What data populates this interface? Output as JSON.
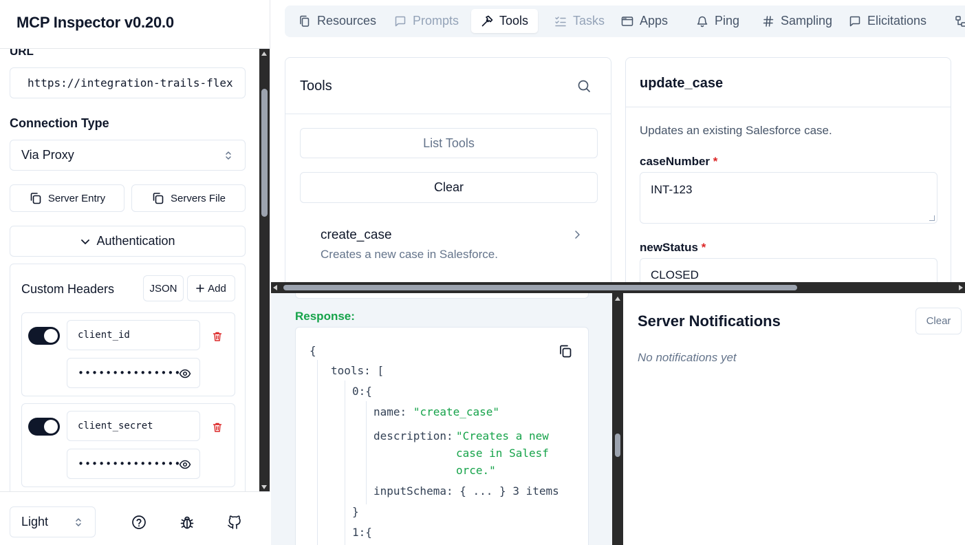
{
  "sidebar": {
    "title": "MCP Inspector v0.20.0",
    "url_label": "URL",
    "url_value": "https://integration-trails-flex",
    "connection_type_label": "Connection Type",
    "connection_type_value": "Via Proxy",
    "server_entry_label": "Server Entry",
    "servers_file_label": "Servers File",
    "authentication_label": "Authentication",
    "custom_headers": {
      "title": "Custom Headers",
      "json_label": "JSON",
      "add_label": "Add",
      "rows": [
        {
          "name": "client_id",
          "value": "••••••••••••••••"
        },
        {
          "name": "client_secret",
          "value": "••••••••••••••••"
        }
      ]
    },
    "theme_value": "Light"
  },
  "tabs": [
    {
      "label": "Resources",
      "icon": "file-copy-icon"
    },
    {
      "label": "Prompts",
      "icon": "message-square-icon"
    },
    {
      "label": "Tools",
      "icon": "hammer-icon"
    },
    {
      "label": "Tasks",
      "icon": "list-checks-icon"
    },
    {
      "label": "Apps",
      "icon": "app-window-icon"
    },
    {
      "label": "Ping",
      "icon": "bell-icon"
    },
    {
      "label": "Sampling",
      "icon": "hash-icon"
    },
    {
      "label": "Elicitations",
      "icon": "message-square-icon"
    }
  ],
  "tools_panel": {
    "title": "Tools",
    "list_tools_label": "List Tools",
    "clear_label": "Clear",
    "items": [
      {
        "name": "create_case",
        "description": "Creates a new case in Salesforce."
      }
    ]
  },
  "detail_panel": {
    "title": "update_case",
    "description": "Updates an existing Salesforce case.",
    "fields": [
      {
        "label": "caseNumber",
        "required": "*",
        "value": "INT-123"
      },
      {
        "label": "newStatus",
        "required": "*",
        "value": "CLOSED"
      }
    ]
  },
  "response": {
    "label": "Response:",
    "json": {
      "open_brace": "{",
      "tools_key": "tools:",
      "open_bracket": "[",
      "item0_key": "0:",
      "item_open": "{",
      "name_key": "name:",
      "name_value": "\"create_case\"",
      "desc_key": "description:",
      "desc_line1": "\"Creates a new",
      "desc_line2": "case in Salesf",
      "desc_line3": "orce.\"",
      "schema_key": "inputSchema:",
      "schema_value": "{ ... }",
      "schema_count": "3 items",
      "item_close": "}",
      "item1_key": "1:",
      "item1_open": "{"
    }
  },
  "notifications": {
    "title": "Server Notifications",
    "clear_label": "Clear",
    "empty_text": "No notifications yet"
  },
  "colors": {
    "accent_dark": "#0f172a",
    "required_red": "#dc2626",
    "response_green": "#16a34a",
    "delete_red": "#dc2626"
  }
}
